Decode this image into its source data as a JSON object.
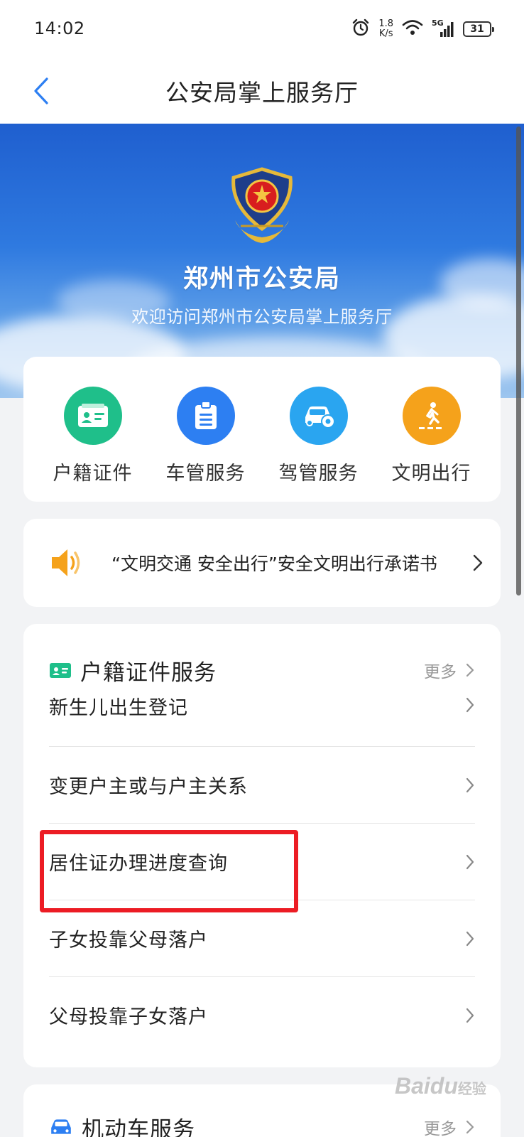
{
  "status_bar": {
    "time": "14:02",
    "net_speed_value": "1.8",
    "net_speed_unit": "K/s",
    "signal_label": "5G",
    "battery": "31"
  },
  "nav": {
    "title": "公安局掌上服务厅",
    "back_icon": "chevron-left-icon"
  },
  "banner": {
    "title": "郑州市公安局",
    "subtitle": "欢迎访问郑州市公安局掌上服务厅",
    "emblem": "police-emblem"
  },
  "quick_services": [
    {
      "label": "户籍证件",
      "icon": "id-card-icon",
      "color": "#1fbf8a"
    },
    {
      "label": "车管服务",
      "icon": "badge-icon",
      "color": "#2d7ff2"
    },
    {
      "label": "驾管服务",
      "icon": "car-gear-icon",
      "color": "#2aa5f0"
    },
    {
      "label": "文明出行",
      "icon": "pedestrian-crossing-icon",
      "color": "#f5a21b"
    }
  ],
  "notice": {
    "icon": "speaker-icon",
    "text": "“文明交通 安全出行”安全文明出行承诺书"
  },
  "household_section": {
    "title": "户籍证件服务",
    "more": "更多",
    "items": [
      {
        "label": "新生儿出生登记"
      },
      {
        "label": "变更户主或与户主关系"
      },
      {
        "label": "居住证办理进度查询"
      },
      {
        "label": "子女投靠父母落户"
      },
      {
        "label": "父母投靠子女落户"
      }
    ]
  },
  "vehicle_section": {
    "title": "机动车服务",
    "more": "更多"
  },
  "watermark": {
    "brand": "Baidu",
    "suffix": "经验"
  },
  "colors": {
    "accent_blue": "#2d7ff2",
    "highlight_red": "#ec1c24"
  }
}
